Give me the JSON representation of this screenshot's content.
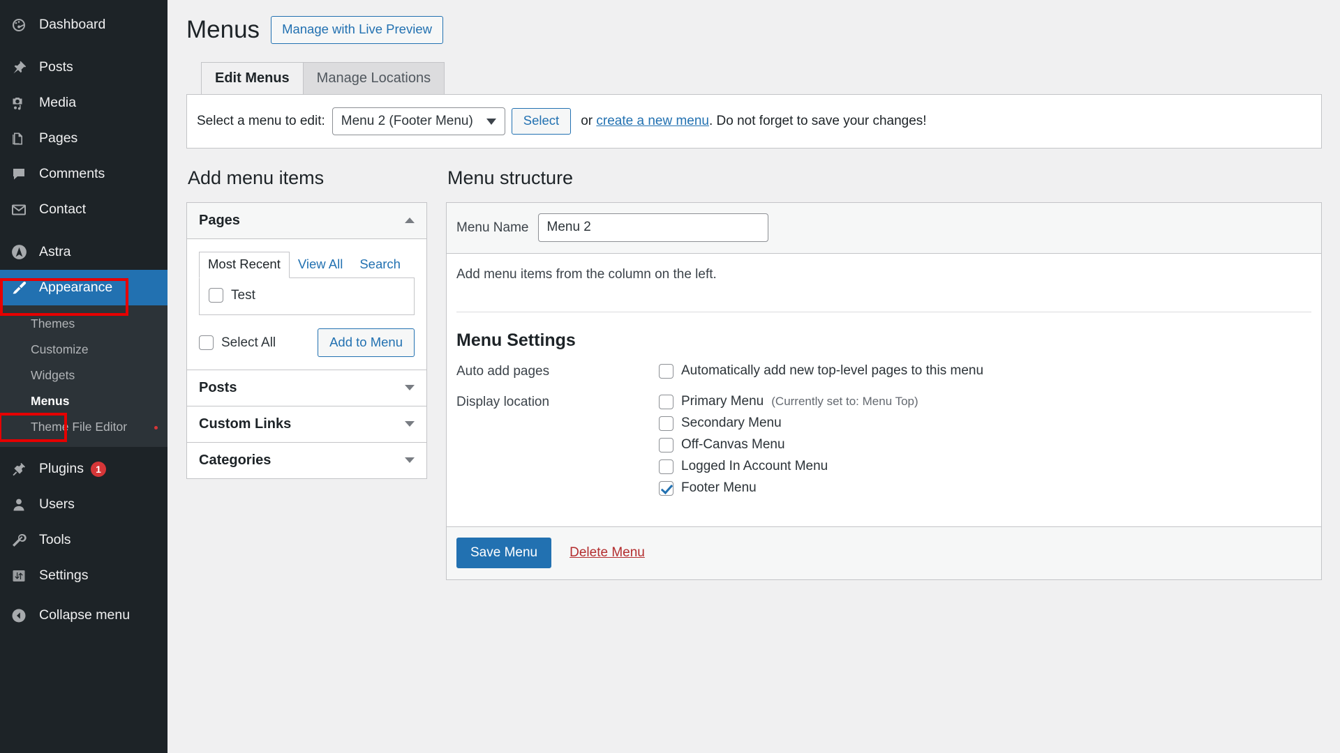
{
  "sidebar": {
    "items": [
      {
        "label": "Dashboard",
        "icon": "dashboard-icon",
        "name": "dashboard"
      },
      {
        "label": "Posts",
        "icon": "pin-icon",
        "name": "posts"
      },
      {
        "label": "Media",
        "icon": "media-icon",
        "name": "media"
      },
      {
        "label": "Pages",
        "icon": "pages-icon",
        "name": "pages"
      },
      {
        "label": "Comments",
        "icon": "comment-icon",
        "name": "comments"
      },
      {
        "label": "Contact",
        "icon": "envelope-icon",
        "name": "contact"
      },
      {
        "label": "Astra",
        "icon": "astra-icon",
        "name": "astra"
      },
      {
        "label": "Appearance",
        "icon": "brush-icon",
        "name": "appearance"
      },
      {
        "label": "Plugins",
        "icon": "plug-icon",
        "name": "plugins",
        "badge": "1"
      },
      {
        "label": "Users",
        "icon": "user-icon",
        "name": "users"
      },
      {
        "label": "Tools",
        "icon": "wrench-icon",
        "name": "tools"
      },
      {
        "label": "Settings",
        "icon": "sliders-icon",
        "name": "settings"
      }
    ],
    "appearance_submenu": [
      {
        "label": "Themes"
      },
      {
        "label": "Customize"
      },
      {
        "label": "Widgets"
      },
      {
        "label": "Menus"
      },
      {
        "label": "Theme File Editor"
      }
    ],
    "collapse_label": "Collapse menu"
  },
  "header": {
    "title": "Menus",
    "live_preview_button": "Manage with Live Preview",
    "tabs": [
      {
        "label": "Edit Menus",
        "active": true
      },
      {
        "label": "Manage Locations",
        "active": false
      }
    ]
  },
  "select_bar": {
    "label": "Select a menu to edit:",
    "selected_menu": "Menu 2 (Footer Menu)",
    "options": [
      "Menu 2 (Footer Menu)"
    ],
    "select_button": "Select",
    "or_text": "or ",
    "create_link": "create a new menu",
    "tail_text": ". Do not forget to save your changes!"
  },
  "add_menu_items": {
    "heading": "Add menu items",
    "sections": [
      {
        "title": "Pages",
        "open": true,
        "tabs": [
          {
            "label": "Most Recent",
            "active": true
          },
          {
            "label": "View All",
            "active": false
          },
          {
            "label": "Search",
            "active": false
          }
        ],
        "items": [
          {
            "label": "Test",
            "checked": false
          }
        ],
        "select_all_label": "Select All",
        "select_all_checked": false,
        "add_button": "Add to Menu"
      },
      {
        "title": "Posts",
        "open": false
      },
      {
        "title": "Custom Links",
        "open": false
      },
      {
        "title": "Categories",
        "open": false
      }
    ]
  },
  "menu_structure": {
    "heading": "Menu structure",
    "menu_name_label": "Menu Name",
    "menu_name_value": "Menu 2",
    "empty_note": "Add menu items from the column on the left.",
    "settings": {
      "title": "Menu Settings",
      "auto_add_label": "Auto add pages",
      "auto_add_option": "Automatically add new top-level pages to this menu",
      "auto_add_checked": false,
      "display_location_label": "Display location",
      "locations": [
        {
          "label": "Primary Menu",
          "note": "(Currently set to: Menu Top)",
          "checked": false
        },
        {
          "label": "Secondary Menu",
          "note": "",
          "checked": false
        },
        {
          "label": "Off-Canvas Menu",
          "note": "",
          "checked": false
        },
        {
          "label": "Logged In Account Menu",
          "note": "",
          "checked": false
        },
        {
          "label": "Footer Menu",
          "note": "",
          "checked": true
        }
      ]
    },
    "save_button": "Save Menu",
    "delete_link": "Delete Menu"
  },
  "colors": {
    "sidebar_bg": "#1d2327",
    "submenu_bg": "#2c3338",
    "accent_blue": "#2271b1",
    "danger_red": "#b32d2e",
    "badge_red": "#d63638",
    "annotation_red": "#e60000"
  }
}
